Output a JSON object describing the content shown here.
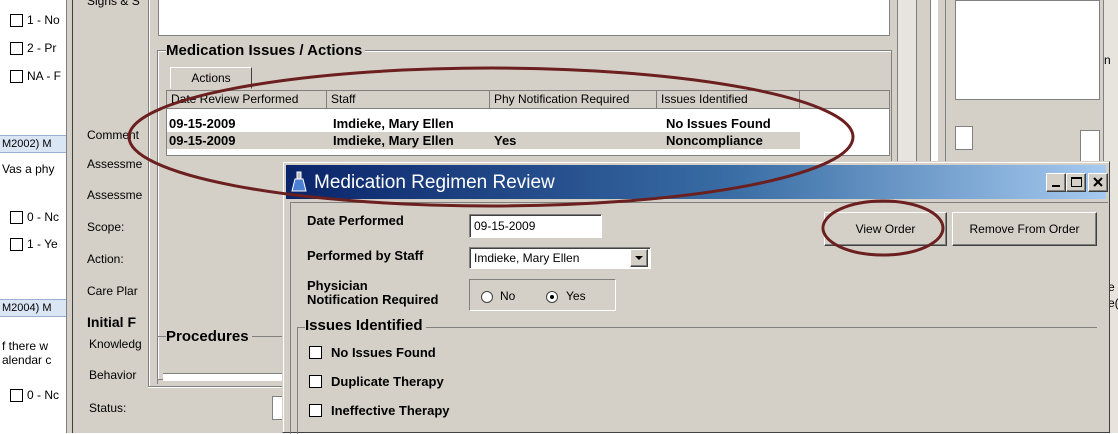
{
  "left_panel": {
    "options_top": [
      "1 - No",
      "2 - Pr",
      "NA - F"
    ],
    "section1": "M2002) M",
    "section1_text": "Vas a phy",
    "options_mid": [
      "0 - Nc",
      "1 - Ye"
    ],
    "section2": "M2004) M",
    "section2_lines": [
      "f there w",
      "alendar c"
    ],
    "options_bottom": [
      "0 - Nc"
    ]
  },
  "middle_labels": {
    "signs": "Signs & S",
    "comments": "Comment",
    "assessment1": "Assessme",
    "assessment2": "Assessme",
    "scope": "Scope:",
    "action": "Action:",
    "careplan": "Care Plar",
    "initial": "Initial F",
    "knowledge": "Knowledg",
    "behavior": "Behavior",
    "status": "Status:"
  },
  "issues_panel": {
    "title": "Medication Issues / Actions",
    "tab_actions": "Actions",
    "columns": [
      "Date Review Performed",
      "Staff",
      "Phy Notification Required",
      "Issues Identified"
    ],
    "rows": [
      {
        "date": "09-15-2009",
        "staff": "Imdieke, Mary Ellen",
        "phy": "",
        "issues": "No Issues Found"
      },
      {
        "date": "09-15-2009",
        "staff": "Imdieke, Mary Ellen",
        "phy": "Yes",
        "issues": "Noncompliance"
      }
    ],
    "procedures_title": "Procedures"
  },
  "dialog": {
    "title": "Medication Regimen Review",
    "date_label": "Date Performed",
    "date_value": "09-15-2009",
    "staff_label": "Performed by Staff",
    "staff_value": "Imdieke, Mary Ellen",
    "phy_label_1": "Physician",
    "phy_label_2": "Notification Required",
    "radio_no": "No",
    "radio_yes": "Yes",
    "radio_selected": "Yes",
    "view_order": "View Order",
    "remove_from_order": "Remove From Order",
    "issues_title": "Issues Identified",
    "issues": [
      "No Issues Found",
      "Duplicate Therapy",
      "Ineffective Therapy"
    ]
  },
  "right_fragments": {
    "r1": "n",
    "r2": "e",
    "r3": "e("
  },
  "colors": {
    "title_bar_start": "#0a246a",
    "title_bar_end": "#a6caf0",
    "annotation": "#6b1f1f",
    "selected_row": "#d4d0c8"
  },
  "icons": {
    "dialog": "flask-icon",
    "minimize": "minimize-icon",
    "maximize": "maximize-icon",
    "close": "close-icon",
    "dropdown": "chevron-down-icon"
  }
}
